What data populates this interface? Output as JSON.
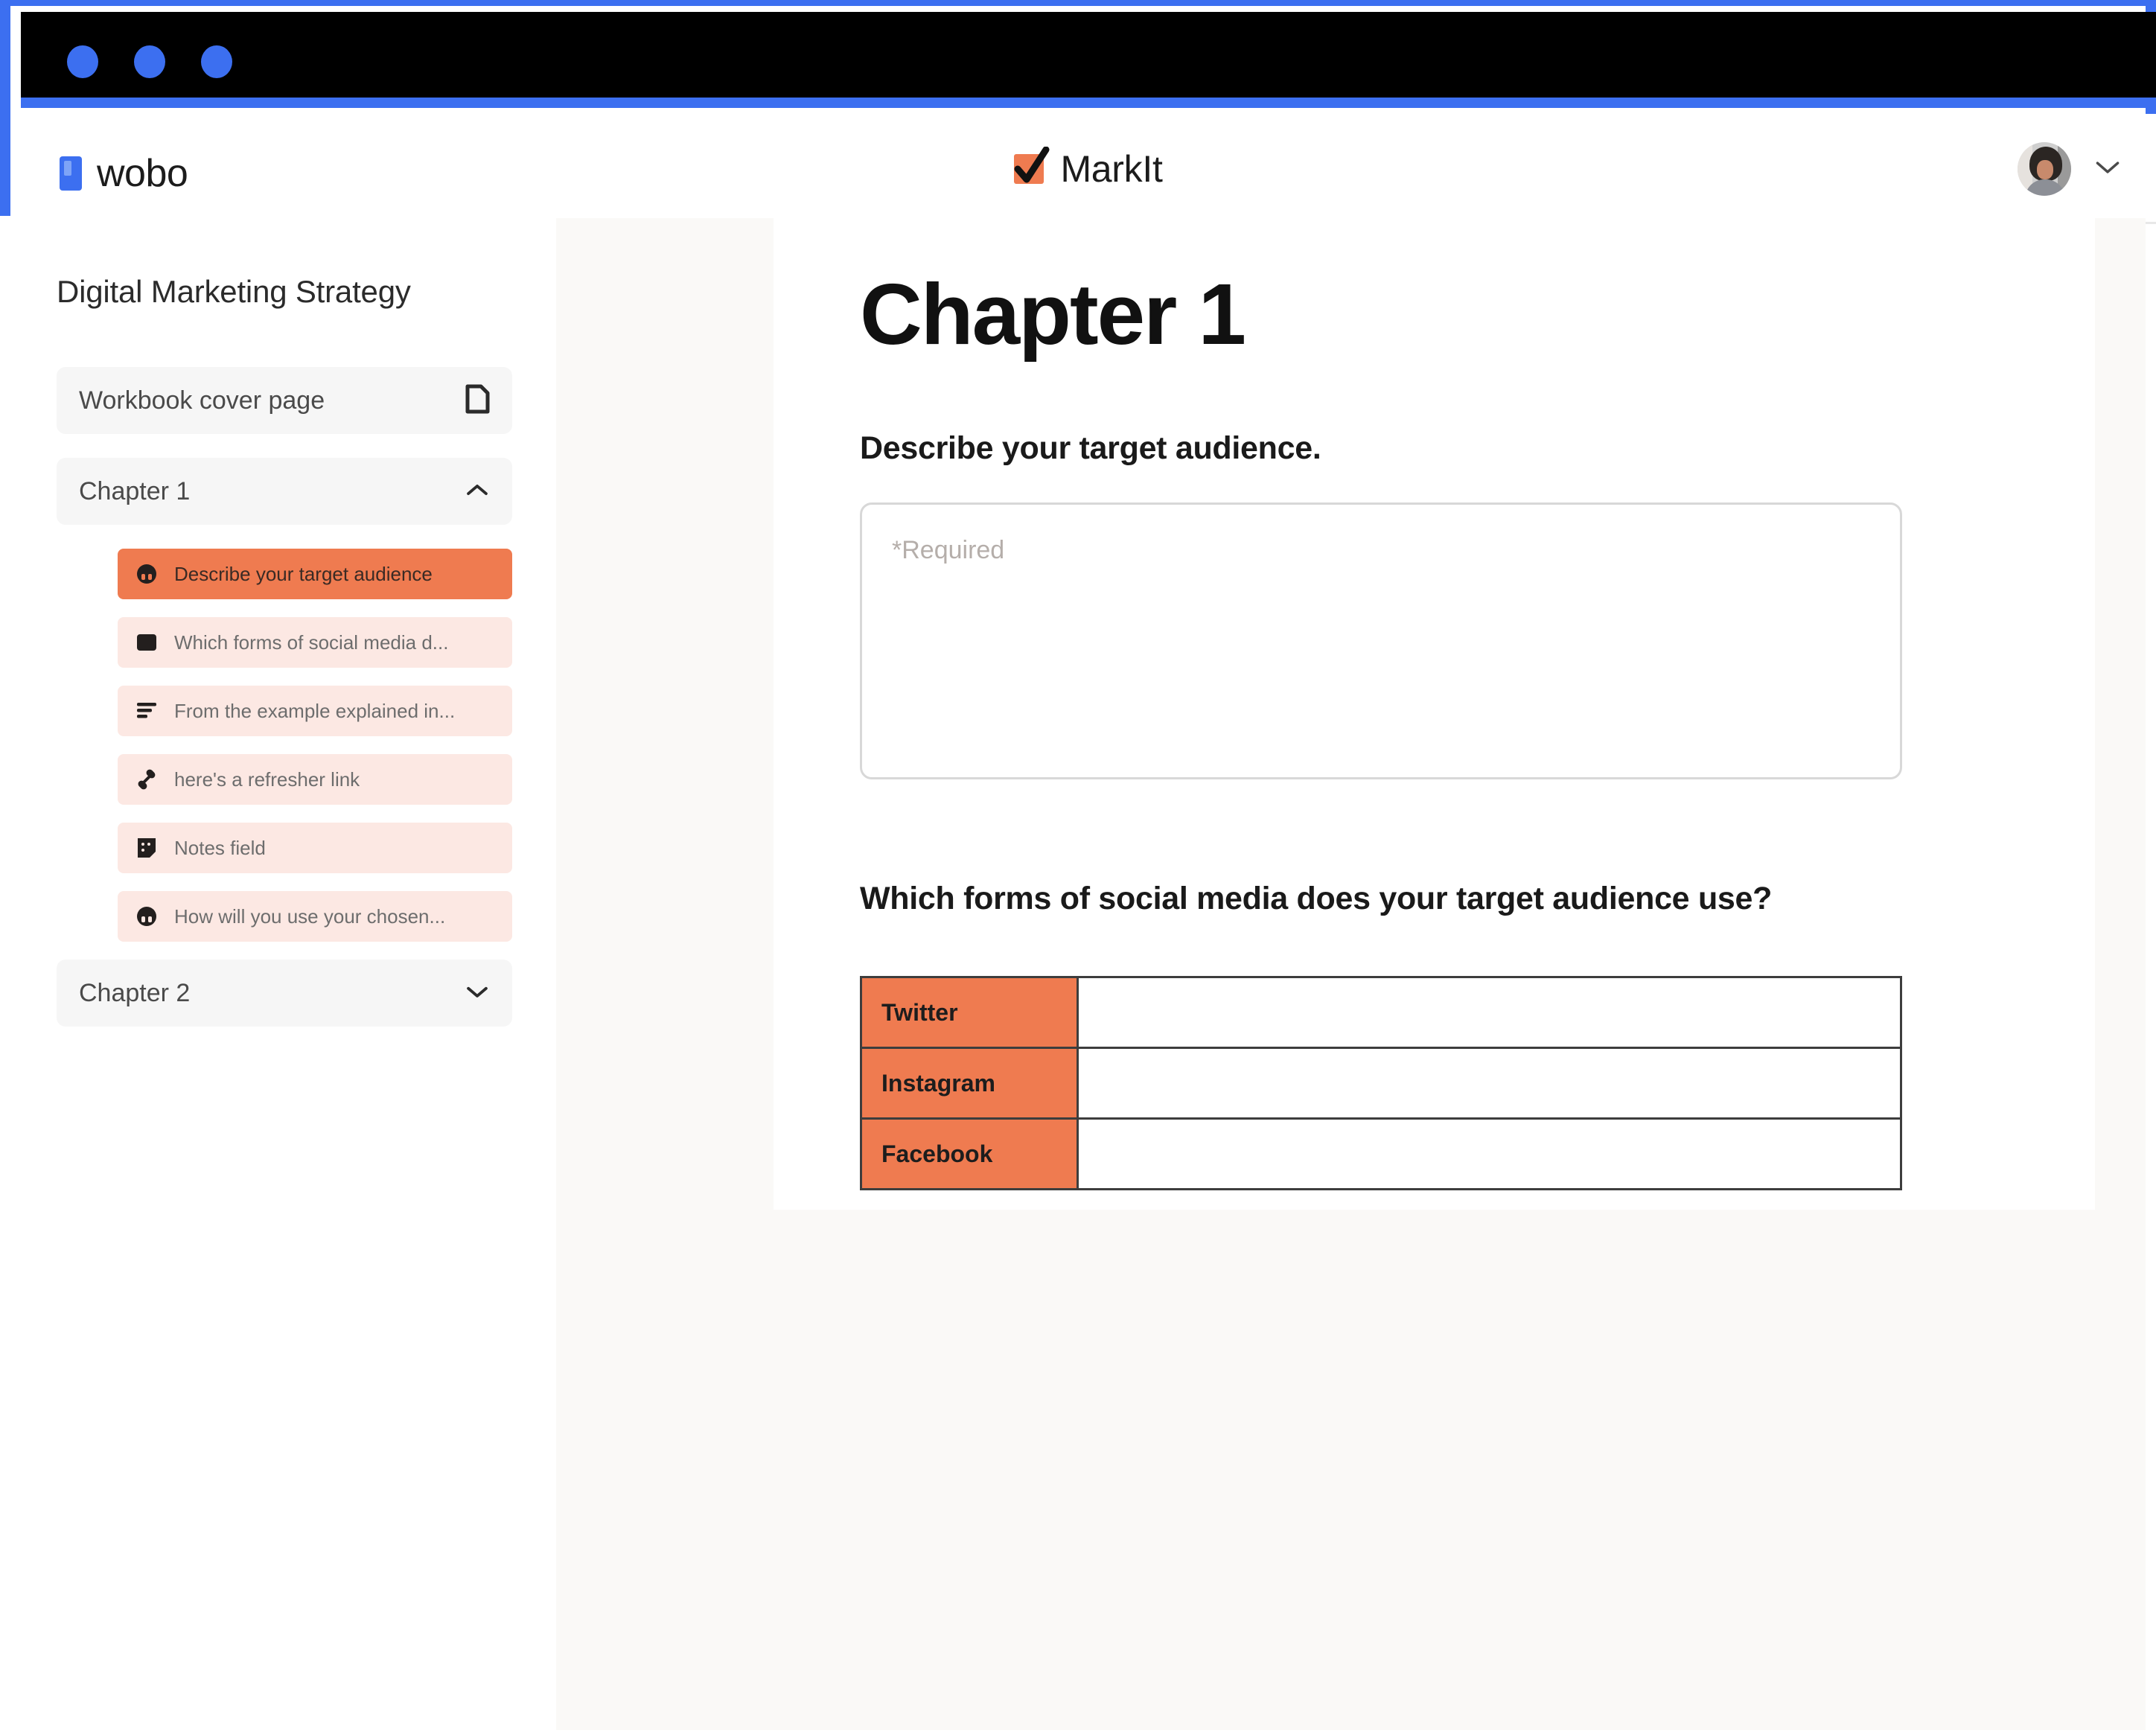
{
  "window": {
    "traffic_lights": [
      "close",
      "minimize",
      "maximize"
    ],
    "accent_color": "#3C6FF0",
    "titlebar_color": "#000000"
  },
  "header": {
    "brand_name": "wobo",
    "document_title": "MarkIt",
    "document_icon": "orange-checkbox-icon",
    "avatar_alt": "user-avatar",
    "chevron": "chevron-down-icon"
  },
  "sidebar": {
    "title": "Digital Marketing Strategy",
    "items": [
      {
        "label": "Workbook cover page",
        "icon": "page-icon",
        "expandable": false,
        "active": false
      },
      {
        "label": "Chapter 1",
        "icon": "chevron-up-icon",
        "expandable": true,
        "expanded": true,
        "active": false
      },
      {
        "label": "Chapter 2",
        "icon": "chevron-down-icon",
        "expandable": true,
        "expanded": false,
        "active": false
      }
    ],
    "chapter1_children": [
      {
        "label": "Describe your target audience",
        "icon": "short-answer-icon",
        "active": true
      },
      {
        "label": "Which forms of social media d...",
        "icon": "table-icon",
        "active": false
      },
      {
        "label": "From the example explained in...",
        "icon": "paragraph-icon",
        "active": false
      },
      {
        "label": "here's a refresher link",
        "icon": "link-icon",
        "active": false
      },
      {
        "label": "Notes field",
        "icon": "note-icon",
        "active": false
      },
      {
        "label": "How will you use your chosen...",
        "icon": "short-answer-icon",
        "active": false
      }
    ],
    "active_color": "#EF7B50",
    "inactive_color": "#FCE8E3"
  },
  "page": {
    "chapter_heading": "Chapter 1",
    "question_1": "Describe your target audience.",
    "answer_1_value": "",
    "answer_1_placeholder": "*Required",
    "question_2": "Which forms of social media does your target audience use?",
    "table": {
      "rows": [
        {
          "label": "Twitter",
          "value": ""
        },
        {
          "label": "Instagram",
          "value": ""
        },
        {
          "label": "Facebook",
          "value": ""
        }
      ],
      "label_color": "#EF7B50",
      "border_color": "#3d3d3d"
    }
  }
}
